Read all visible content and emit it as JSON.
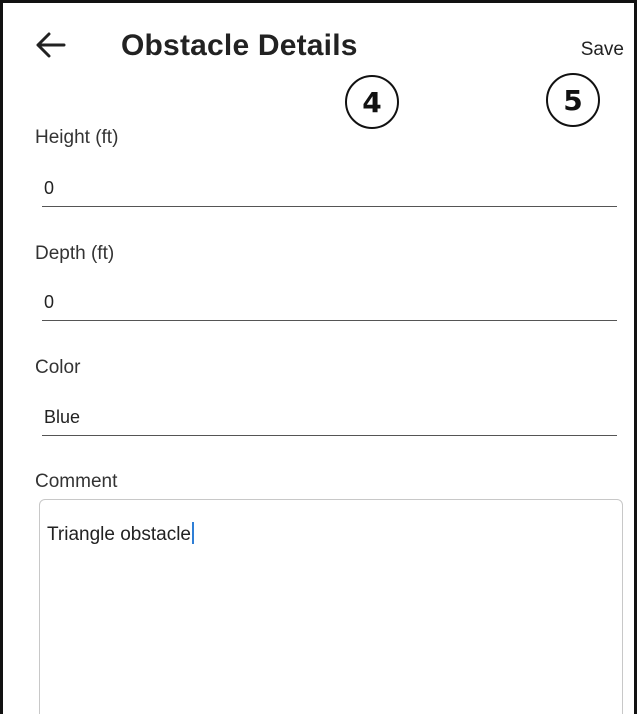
{
  "header": {
    "back_icon": "arrow-left-icon",
    "title": "Obstacle Details",
    "save_label": "Save"
  },
  "annotations": {
    "badge_4": "4",
    "badge_5": "5"
  },
  "form": {
    "height": {
      "label": "Height (ft)",
      "value": "0"
    },
    "depth": {
      "label": "Depth (ft)",
      "value": "0"
    },
    "color": {
      "label": "Color",
      "value": "Blue"
    },
    "comment": {
      "label": "Comment",
      "value": "Triangle obstacle"
    }
  },
  "colors": {
    "caret": "#2f7fd6",
    "underline": "#555555",
    "text": "#222222"
  }
}
